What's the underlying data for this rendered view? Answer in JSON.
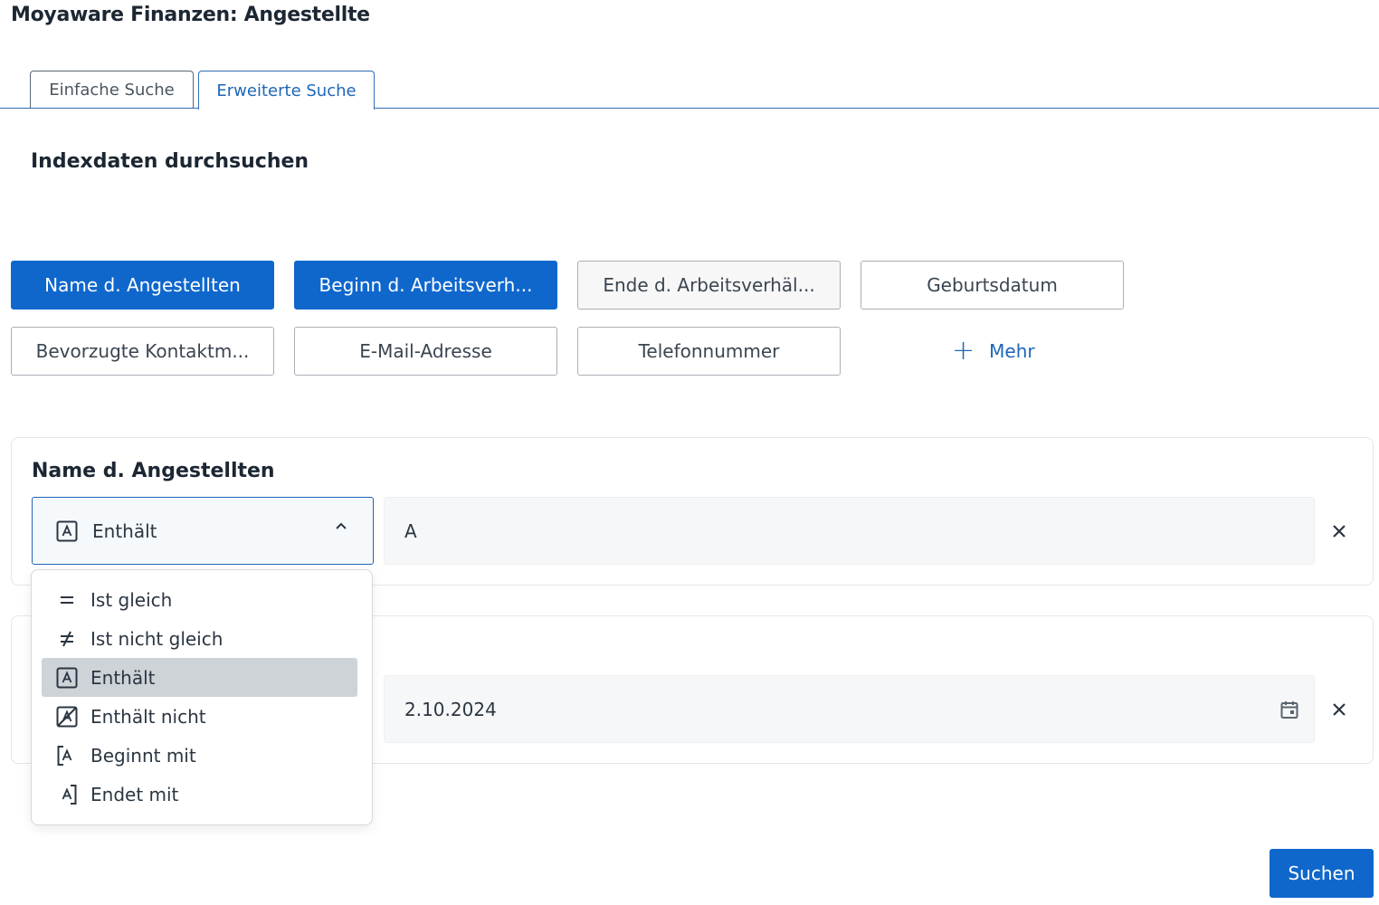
{
  "app": {
    "title": "Moyaware Finanzen: Angestellte"
  },
  "tabs": [
    {
      "label": "Einfache Suche",
      "active": false
    },
    {
      "label": "Erweiterte Suche",
      "active": true
    }
  ],
  "section": {
    "heading": "Indexdaten durchsuchen"
  },
  "fields": [
    {
      "label": "Name d. Angestellten",
      "selected": true
    },
    {
      "label": "Beginn d. Arbeitsverh...",
      "selected": true
    },
    {
      "label": "Ende d. Arbeitsverhäl...",
      "selected": false
    },
    {
      "label": "Geburtsdatum",
      "selected": false
    },
    {
      "label": "Bevorzugte Kontaktm...",
      "selected": false
    },
    {
      "label": "E-Mail-Adresse",
      "selected": false
    },
    {
      "label": "Telefonnummer",
      "selected": false
    }
  ],
  "more": {
    "label": "Mehr",
    "icon": "plus-icon"
  },
  "filters": [
    {
      "title": "Name d. Angestellten",
      "operator": "Enthält",
      "operator_icon": "contains-icon",
      "value": "A"
    },
    {
      "title": "",
      "value": "2.10.2024",
      "icon": "calendar-icon"
    }
  ],
  "operator_menu": {
    "items": [
      {
        "label": "Ist gleich",
        "icon": "equals-icon"
      },
      {
        "label": "Ist nicht gleich",
        "icon": "not-equals-icon"
      },
      {
        "label": "Enthält",
        "icon": "contains-icon",
        "highlighted": true
      },
      {
        "label": "Enthält nicht",
        "icon": "not-contains-icon"
      },
      {
        "label": "Beginnt mit",
        "icon": "starts-with-icon"
      },
      {
        "label": "Endet mit",
        "icon": "ends-with-icon"
      }
    ]
  },
  "actions": {
    "search_label": "Suchen"
  },
  "colors": {
    "primary": "#0f67cc",
    "accent_text": "#1e66b8",
    "highlight": "#ced3d8"
  }
}
